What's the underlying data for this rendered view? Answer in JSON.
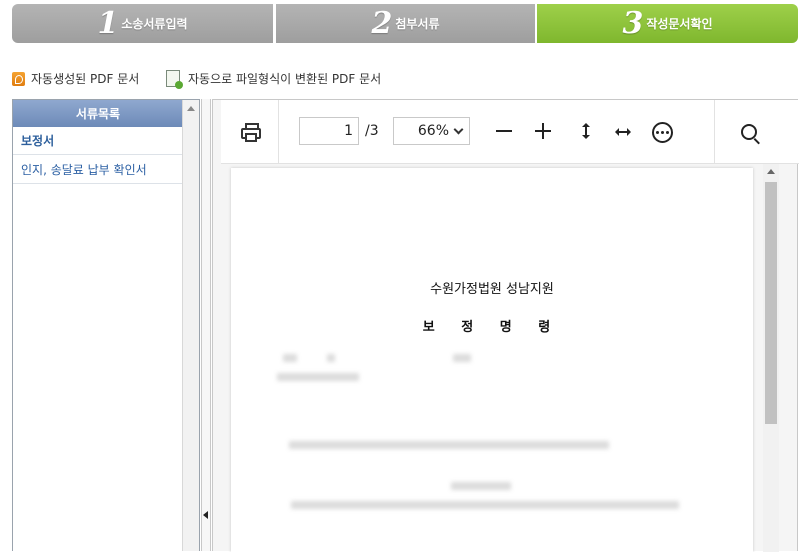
{
  "steps": [
    {
      "num": "1",
      "label": "소송서류입력"
    },
    {
      "num": "2",
      "label": "첨부서류"
    },
    {
      "num": "3",
      "label": "작성문서확인"
    }
  ],
  "file_types": {
    "auto_pdf": "자동생성된 PDF 문서",
    "converted_pdf": "자동으로 파일형식이 변환된 PDF 문서"
  },
  "sidebar": {
    "header": "서류목록",
    "items": [
      {
        "label": "보정서"
      },
      {
        "label": "인지, 송달료 납부 확인서"
      }
    ]
  },
  "viewer": {
    "page_current": "1",
    "page_total": "/3",
    "zoom": "66%"
  },
  "document": {
    "court": "수원가정법원 성남지원",
    "title": "보 정 명 령"
  },
  "colors": {
    "step_active": "#8cc63f",
    "step_inactive": "#a8a8a8",
    "sidebar_header": "#7a94c0",
    "link": "#2b5fa3"
  }
}
